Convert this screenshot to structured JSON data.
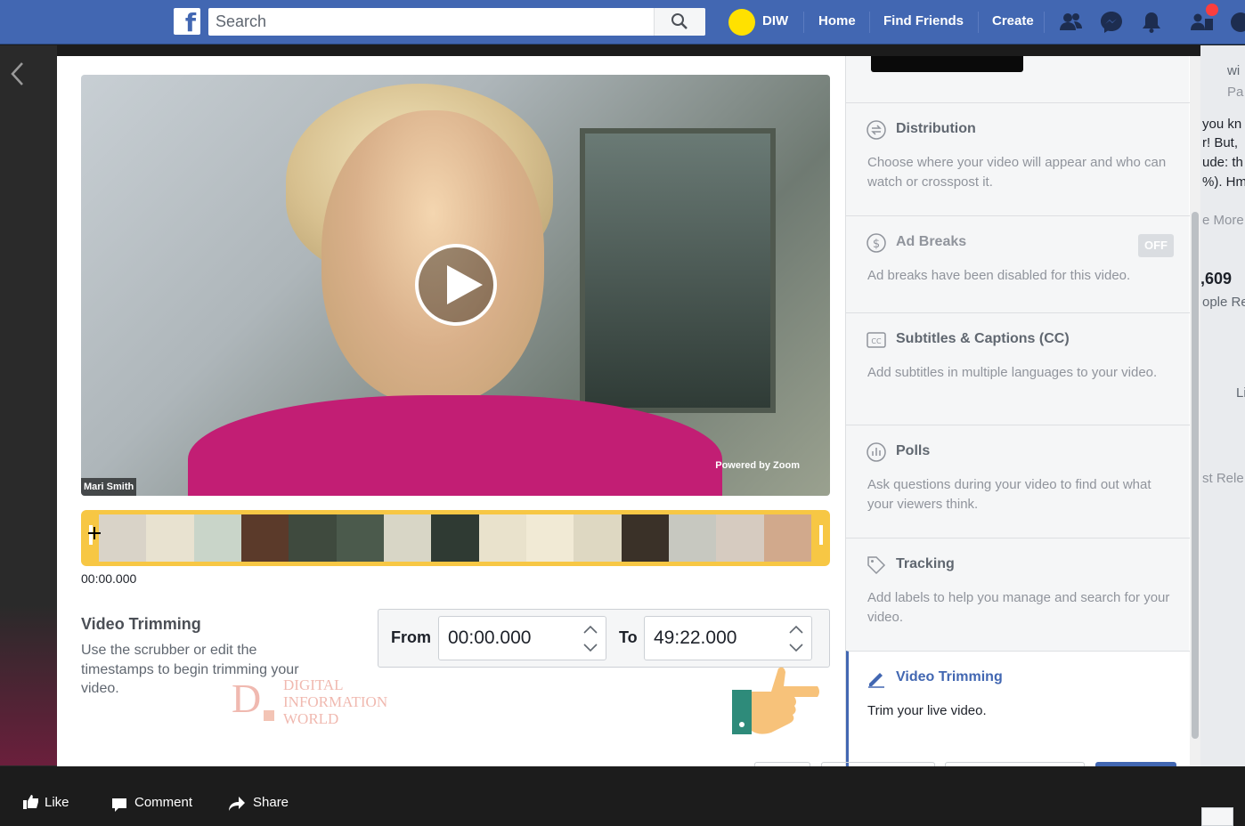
{
  "topbar": {
    "search_placeholder": "Search",
    "profile_name": "DIW",
    "nav": [
      "Home",
      "Find Friends",
      "Create"
    ]
  },
  "video": {
    "name_tag": "Mari Smith",
    "powered_by": "Powered by Zoom",
    "timestamp": "00:00.000"
  },
  "trimming": {
    "title": "Video Trimming",
    "description": "Use the scrubber or edit the timestamps to begin trimming your video.",
    "from_label": "From",
    "from_value": "00:00.000",
    "to_label": "To",
    "to_value": "49:22.000"
  },
  "watermark": {
    "letter": "D",
    "lines": [
      "DIGITAL",
      "INFORMATION",
      "WORLD"
    ]
  },
  "sidebar": {
    "sections": [
      {
        "title": "Distribution",
        "desc": "Choose where your video will appear and who can watch or crosspost it.",
        "icon": "distribution-icon"
      },
      {
        "title": "Ad Breaks",
        "desc": "Ad breaks have been disabled for this video.",
        "icon": "dollar-icon",
        "badge": "OFF"
      },
      {
        "title": "Subtitles & Captions (CC)",
        "desc": "Add subtitles in multiple languages to your video.",
        "icon": "cc-icon"
      },
      {
        "title": "Polls",
        "desc": "Ask questions during your video to find out what your viewers think.",
        "icon": "poll-icon"
      },
      {
        "title": "Tracking",
        "desc": "Add labels to help you manage and search for your video.",
        "icon": "tag-icon"
      },
      {
        "title": "Video Trimming",
        "desc": "Trim your live video.",
        "icon": "pen-icon",
        "active": true
      }
    ]
  },
  "background_feed": {
    "fragments": [
      "wi",
      "Pa",
      "you kn",
      "r! But,",
      "ude: th",
      "%). Hm",
      "e More",
      ",609",
      "ople Re",
      "Li",
      "st Rele"
    ]
  },
  "actions": {
    "like": "Like",
    "comment": "Comment",
    "share": "Share"
  },
  "colors": {
    "brand": "#4267b2",
    "scrubber": "#f7c744",
    "notification": "#fa3e3e"
  }
}
